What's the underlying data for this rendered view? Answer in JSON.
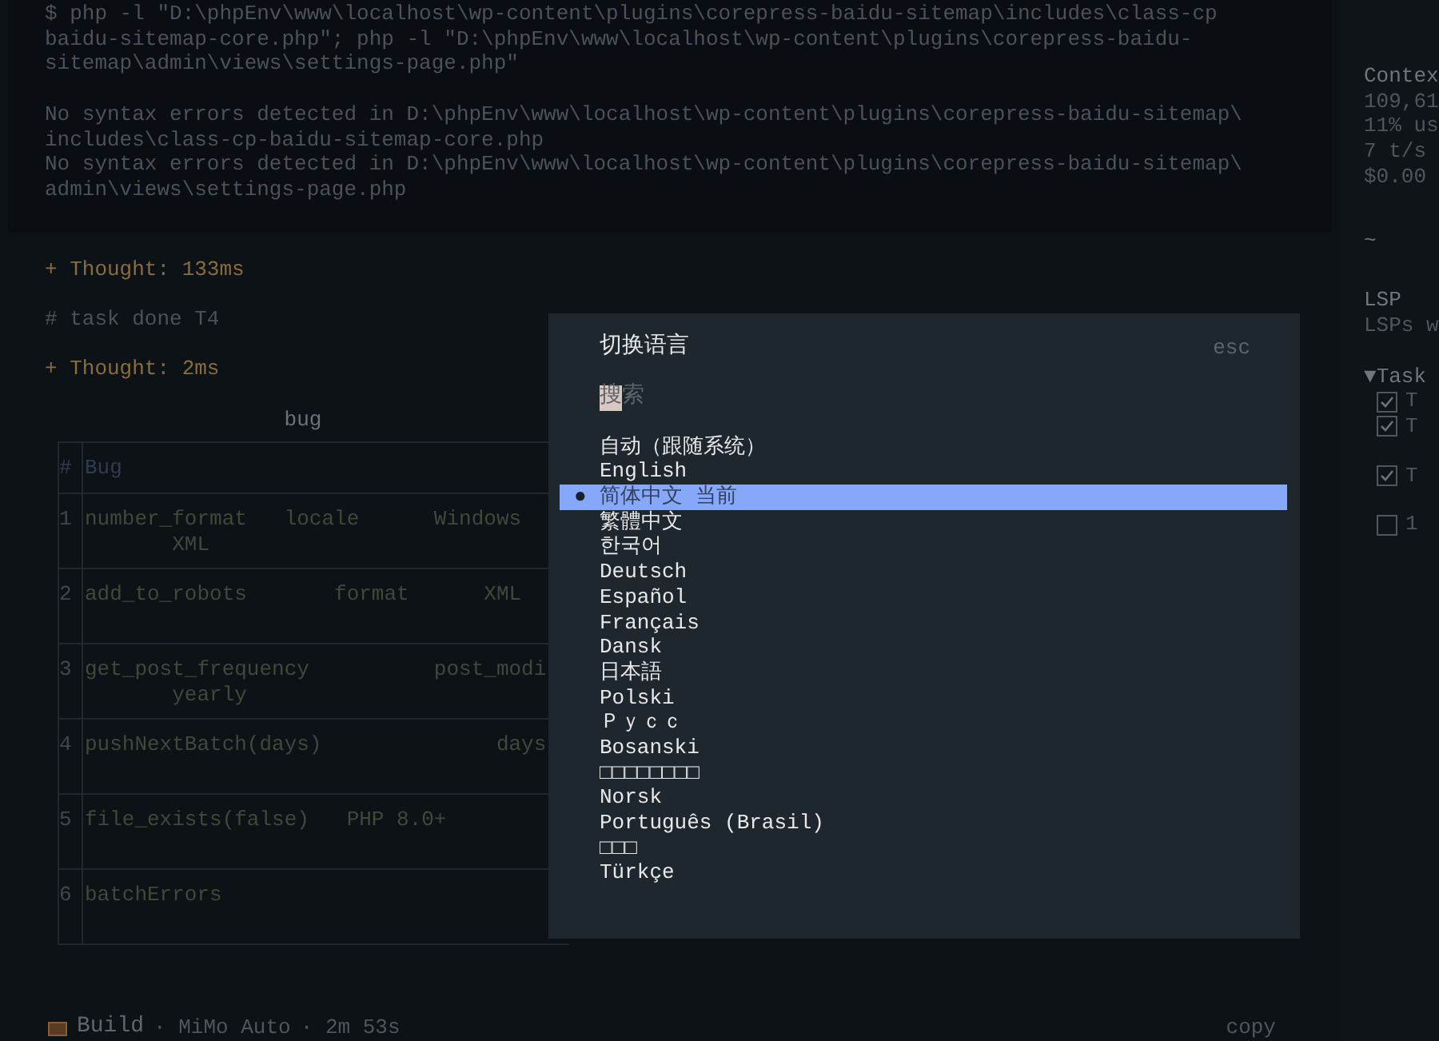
{
  "terminal": {
    "command": [
      "$ php -l \"D:\\phpEnv\\www\\localhost\\wp-content\\plugins\\corepress-baidu-sitemap\\includes\\class-cp",
      "baidu-sitemap-core.php\"; php -l \"D:\\phpEnv\\www\\localhost\\wp-content\\plugins\\corepress-baidu-",
      "sitemap\\admin\\views\\settings-page.php\""
    ],
    "lines": [
      "No syntax errors detected in D:\\phpEnv\\www\\localhost\\wp-content\\plugins\\corepress-baidu-sitemap\\",
      "includes\\class-cp-baidu-sitemap-core.php",
      "No syntax errors detected in D:\\phpEnv\\www\\localhost\\wp-content\\plugins\\corepress-baidu-sitemap\\",
      "admin\\views\\settings-page.php"
    ]
  },
  "log": [
    {
      "kind": "thought",
      "text": "+ Thought: 133ms"
    },
    {
      "kind": "comment",
      "text": "# task done T4"
    },
    {
      "kind": "thought",
      "text": "+ Thought: 2ms"
    }
  ],
  "table": {
    "title": "bug",
    "columns": [
      "#",
      "Bug"
    ],
    "rows": [
      {
        "num": "1",
        "text": "number_format   locale      Windows\n       XML"
      },
      {
        "num": "2",
        "text": "add_to_robots       format      XML"
      },
      {
        "num": "3",
        "text": "get_post_frequency          post_modi\n       yearly"
      },
      {
        "num": "4",
        "text": "pushNextBatch(days)              days"
      },
      {
        "num": "5",
        "text": "file_exists(false)   PHP 8.0+"
      },
      {
        "num": "6",
        "text": "batchErrors"
      }
    ]
  },
  "status_bar": {
    "agent": "Build",
    "model": "· MiMo Auto",
    "time": "· 2m 53s",
    "copy": "copy"
  },
  "sidebar": {
    "context": {
      "title": "Contex",
      "lines": [
        "109,61",
        "11% us",
        "7 t/s",
        "$0.00"
      ]
    },
    "tilde": "~",
    "lsp": {
      "title": "LSP",
      "text": "LSPs w"
    },
    "tasks": {
      "toggle": "▼",
      "title": "Task",
      "expanded": true,
      "items": [
        {
          "checked": true,
          "text": "T"
        },
        {
          "checked": true,
          "text": "T"
        },
        {
          "checked": true,
          "text": "T"
        },
        {
          "checked": false,
          "text": "1"
        }
      ]
    }
  },
  "dialog": {
    "title": "切换语言",
    "close_hint": "esc",
    "search": {
      "placeholder": "搜索"
    },
    "items": [
      {
        "label": "自动（跟随系统）",
        "selected": false
      },
      {
        "label": "English",
        "selected": false
      },
      {
        "label": "简体中文",
        "selected": true,
        "bullet": "●",
        "tag": "当前"
      },
      {
        "label": "繁體中文",
        "selected": false
      },
      {
        "label": "한국어",
        "selected": false
      },
      {
        "label": "Deutsch",
        "selected": false
      },
      {
        "label": "Español",
        "selected": false
      },
      {
        "label": "Français",
        "selected": false
      },
      {
        "label": "Dansk",
        "selected": false
      },
      {
        "label": "日本語",
        "selected": false
      },
      {
        "label": "Polski",
        "selected": false
      },
      {
        "label": "Ｐｙｃｃ",
        "selected": false
      },
      {
        "label": "Bosanski",
        "selected": false
      },
      {
        "label": "□□□□□□□□",
        "selected": false
      },
      {
        "label": "Norsk",
        "selected": false
      },
      {
        "label": "Português (Brasil)",
        "selected": false
      },
      {
        "label": "□□□",
        "selected": false
      },
      {
        "label": "Türkçe",
        "selected": false
      }
    ]
  }
}
